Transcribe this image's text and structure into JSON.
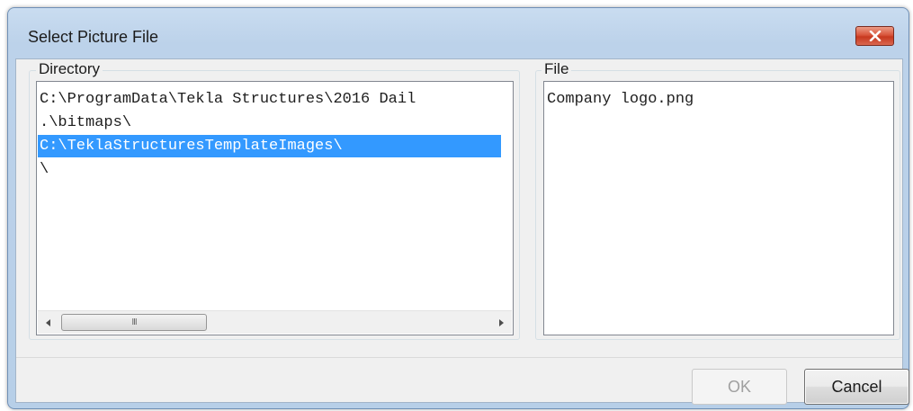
{
  "window": {
    "title": "Select Picture File"
  },
  "directory": {
    "label": "Directory",
    "items": [
      "C:\\ProgramData\\Tekla Structures\\2016 Dail",
      ".\\bitmaps\\",
      "C:\\TeklaStructuresTemplateImages\\",
      "\\"
    ],
    "selected_index": 2,
    "scroll_thumb_glyph": "III"
  },
  "file": {
    "label": "File",
    "items": [
      "Company logo.png"
    ]
  },
  "buttons": {
    "ok_label": "OK",
    "ok_enabled": false,
    "cancel_label": "Cancel"
  },
  "colors": {
    "selection": "#3399ff",
    "close_button": "#c7381f",
    "titlebar": "#bcd2ea"
  },
  "icons": {
    "close": "close-icon",
    "scroll_left": "chevron-left-icon",
    "scroll_right": "chevron-right-icon",
    "scroll_grip": "grip-icon"
  }
}
